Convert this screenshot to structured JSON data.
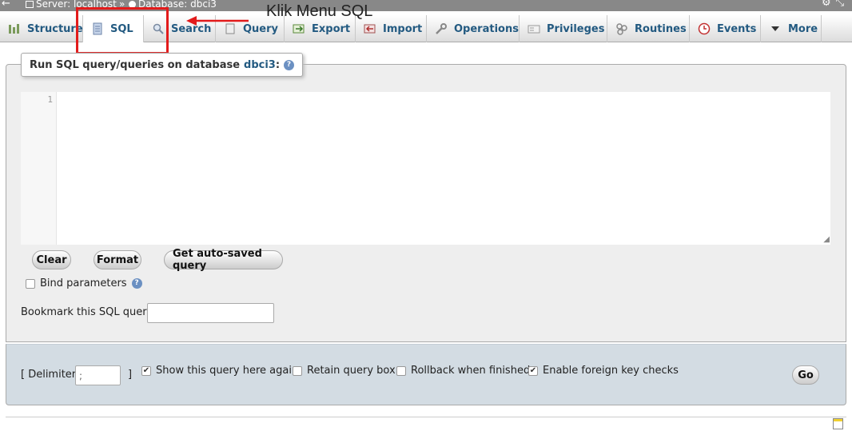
{
  "breadcrumb": {
    "server_label": "Server: localhost",
    "separator": "»",
    "database_label": "Database: dbci3"
  },
  "tabs": [
    {
      "label": "Structure",
      "icon": "structure-icon"
    },
    {
      "label": "SQL",
      "icon": "sql-icon",
      "active": true
    },
    {
      "label": "Search",
      "icon": "search-icon"
    },
    {
      "label": "Query",
      "icon": "query-icon"
    },
    {
      "label": "Export",
      "icon": "export-icon"
    },
    {
      "label": "Import",
      "icon": "import-icon"
    },
    {
      "label": "Operations",
      "icon": "wrench-icon"
    },
    {
      "label": "Privileges",
      "icon": "privileges-icon"
    },
    {
      "label": "Routines",
      "icon": "routines-icon"
    },
    {
      "label": "Events",
      "icon": "clock-icon"
    },
    {
      "label": "More",
      "icon": "triangle-down-icon"
    }
  ],
  "annotation": {
    "text": "Klik Menu SQL",
    "color": "#e21b1b"
  },
  "panel": {
    "title_prefix": "Run SQL query/queries on database",
    "database": "dbci3",
    "title_suffix": ":"
  },
  "editor": {
    "line_number": "1",
    "content": ""
  },
  "buttons": {
    "clear": "Clear",
    "format": "Format",
    "auto_saved": "Get auto-saved query",
    "go": "Go"
  },
  "bind_parameters": {
    "label": "Bind parameters",
    "checked": false
  },
  "bookmark": {
    "label": "Bookmark this SQL query:",
    "value": ""
  },
  "options": {
    "delimiter_open": "[ Delimiter",
    "delimiter_value": ";",
    "delimiter_close": "]",
    "show_query": {
      "label": "Show this query here again",
      "checked": true
    },
    "retain_box": {
      "label": "Retain query box",
      "checked": false
    },
    "rollback": {
      "label": "Rollback when finished",
      "checked": false
    },
    "foreign_keys": {
      "label": "Enable foreign key checks",
      "checked": true
    }
  },
  "colors": {
    "link_blue": "#235a81",
    "panel_bg": "#eeeeee",
    "footer_bg": "#d3dce3"
  }
}
